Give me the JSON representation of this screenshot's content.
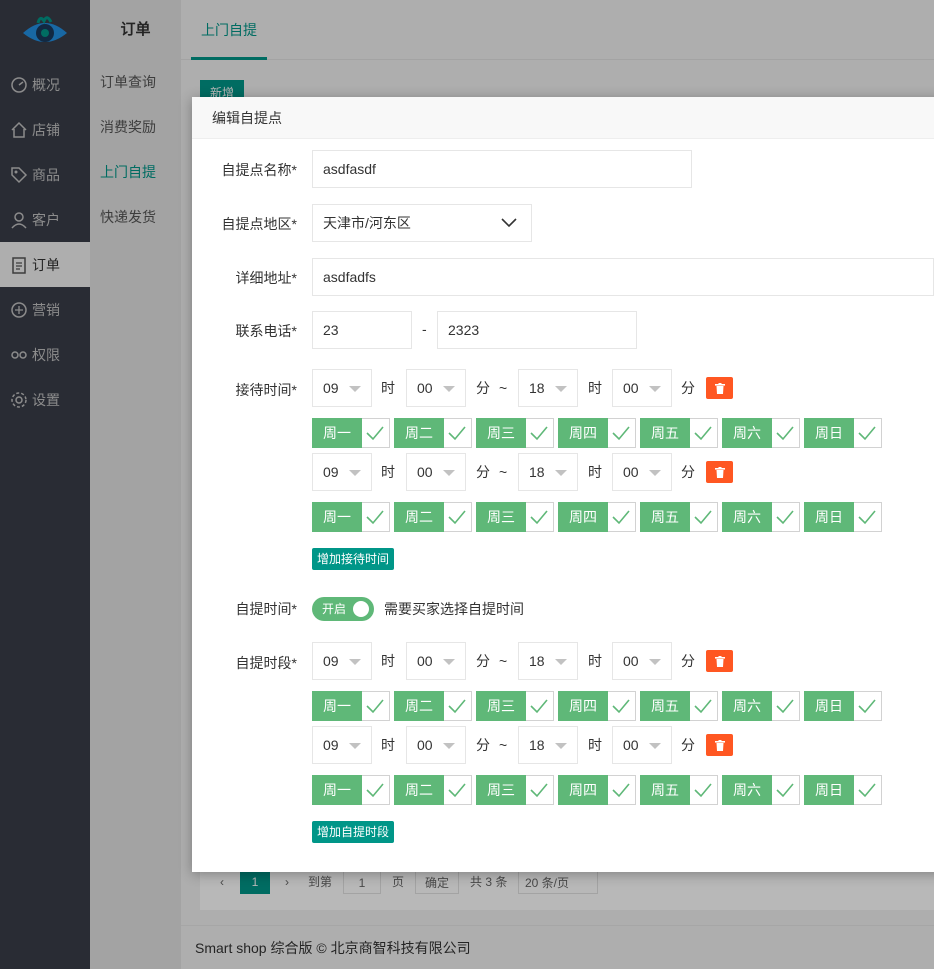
{
  "sidebar": {
    "items": [
      {
        "label": "概况",
        "icon": "dashboard-icon"
      },
      {
        "label": "店铺",
        "icon": "home-icon"
      },
      {
        "label": "商品",
        "icon": "tag-icon"
      },
      {
        "label": "客户",
        "icon": "user-icon"
      },
      {
        "label": "订单",
        "icon": "clipboard-icon",
        "active": true
      },
      {
        "label": "营销",
        "icon": "marketing-icon"
      },
      {
        "label": "权限",
        "icon": "permission-icon"
      },
      {
        "label": "设置",
        "icon": "gear-icon"
      }
    ]
  },
  "subnav": {
    "title": "订单",
    "items": [
      "订单查询",
      "消费奖励",
      "上门自提",
      "快递发货"
    ],
    "active_index": 2
  },
  "tabs": {
    "active": "上门自提"
  },
  "background": {
    "new_button": "新增",
    "pager": {
      "current_page": "1",
      "goto_label": "到第",
      "page_input": "1",
      "page_unit": "页",
      "confirm": "确定",
      "total": "共 3 条",
      "page_size": "20 条/页"
    },
    "footer": "Smart shop 综合版 © 北京商智科技有限公司"
  },
  "dialog": {
    "title": "编辑自提点",
    "name": {
      "label": "自提点名称*",
      "value": "asdfasdf"
    },
    "region": {
      "label": "自提点地区*",
      "value": "天津市/河东区"
    },
    "address": {
      "label": "详细地址*",
      "value": "asdfadfs"
    },
    "phone": {
      "label": "联系电话*",
      "area": "23",
      "dash": "-",
      "number": "2323"
    },
    "units": {
      "hour": "时",
      "minute": "分",
      "tilde": "~"
    },
    "weekdays": [
      "周一",
      "周二",
      "周三",
      "周四",
      "周五",
      "周六",
      "周日"
    ],
    "reception": {
      "label": "接待时间*",
      "slots": [
        {
          "start_h": "09",
          "start_m": "00",
          "end_h": "18",
          "end_m": "00"
        },
        {
          "start_h": "09",
          "start_m": "00",
          "end_h": "18",
          "end_m": "00"
        }
      ],
      "add_label": "增加接待时间"
    },
    "pickup_toggle": {
      "label": "自提时间*",
      "state_text": "开启",
      "on": true,
      "description": "需要买家选择自提时间"
    },
    "pickup_slots": {
      "label": "自提时段*",
      "slots": [
        {
          "start_h": "09",
          "start_m": "00",
          "end_h": "18",
          "end_m": "00"
        },
        {
          "start_h": "09",
          "start_m": "00",
          "end_h": "18",
          "end_m": "00"
        }
      ],
      "add_label": "增加自提时段"
    }
  },
  "colors": {
    "accent": "#009688",
    "green": "#5fb878",
    "danger": "#ff5722",
    "sidebar": "#393d49"
  }
}
